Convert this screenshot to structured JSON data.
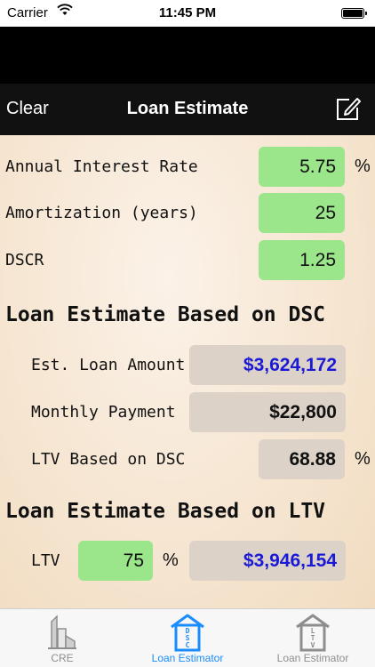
{
  "status_bar": {
    "carrier": "Carrier",
    "time": "11:45 PM"
  },
  "nav": {
    "clear_label": "Clear",
    "title": "Loan Estimate",
    "edit_icon": "compose-icon"
  },
  "inputs": {
    "interest_rate": {
      "label": "Annual Interest Rate",
      "value": "5.75",
      "unit": "%"
    },
    "amortization": {
      "label": "Amortization (years)",
      "value": "25"
    },
    "dscr": {
      "label": "DSCR",
      "value": "1.25"
    }
  },
  "dsc_section": {
    "title": "Loan Estimate Based on DSC",
    "loan_amount": {
      "label": "Est. Loan Amount",
      "value": "$3,624,172"
    },
    "monthly_payment": {
      "label": "Monthly Payment",
      "value": "$22,800"
    },
    "ltv": {
      "label": "LTV Based on DSC",
      "value": "68.88",
      "unit": "%"
    }
  },
  "ltv_section": {
    "title": "Loan Estimate Based on LTV",
    "ltv": {
      "label": "LTV",
      "value": "75",
      "unit": "%"
    },
    "loan_amount": {
      "value": "$3,946,154"
    }
  },
  "tabs": [
    {
      "label": "CRE",
      "icon": "cre-building-icon",
      "active": false
    },
    {
      "label": "Loan Estimator",
      "icon": "dsc-house-icon",
      "active": true
    },
    {
      "label": "Loan Estimator",
      "icon": "ltv-house-icon",
      "active": false
    }
  ],
  "colors": {
    "accent": "#1a8cff",
    "input_green": "#9be58a",
    "result_gray": "#dcd2c8",
    "result_blue": "#1a1ad6"
  }
}
